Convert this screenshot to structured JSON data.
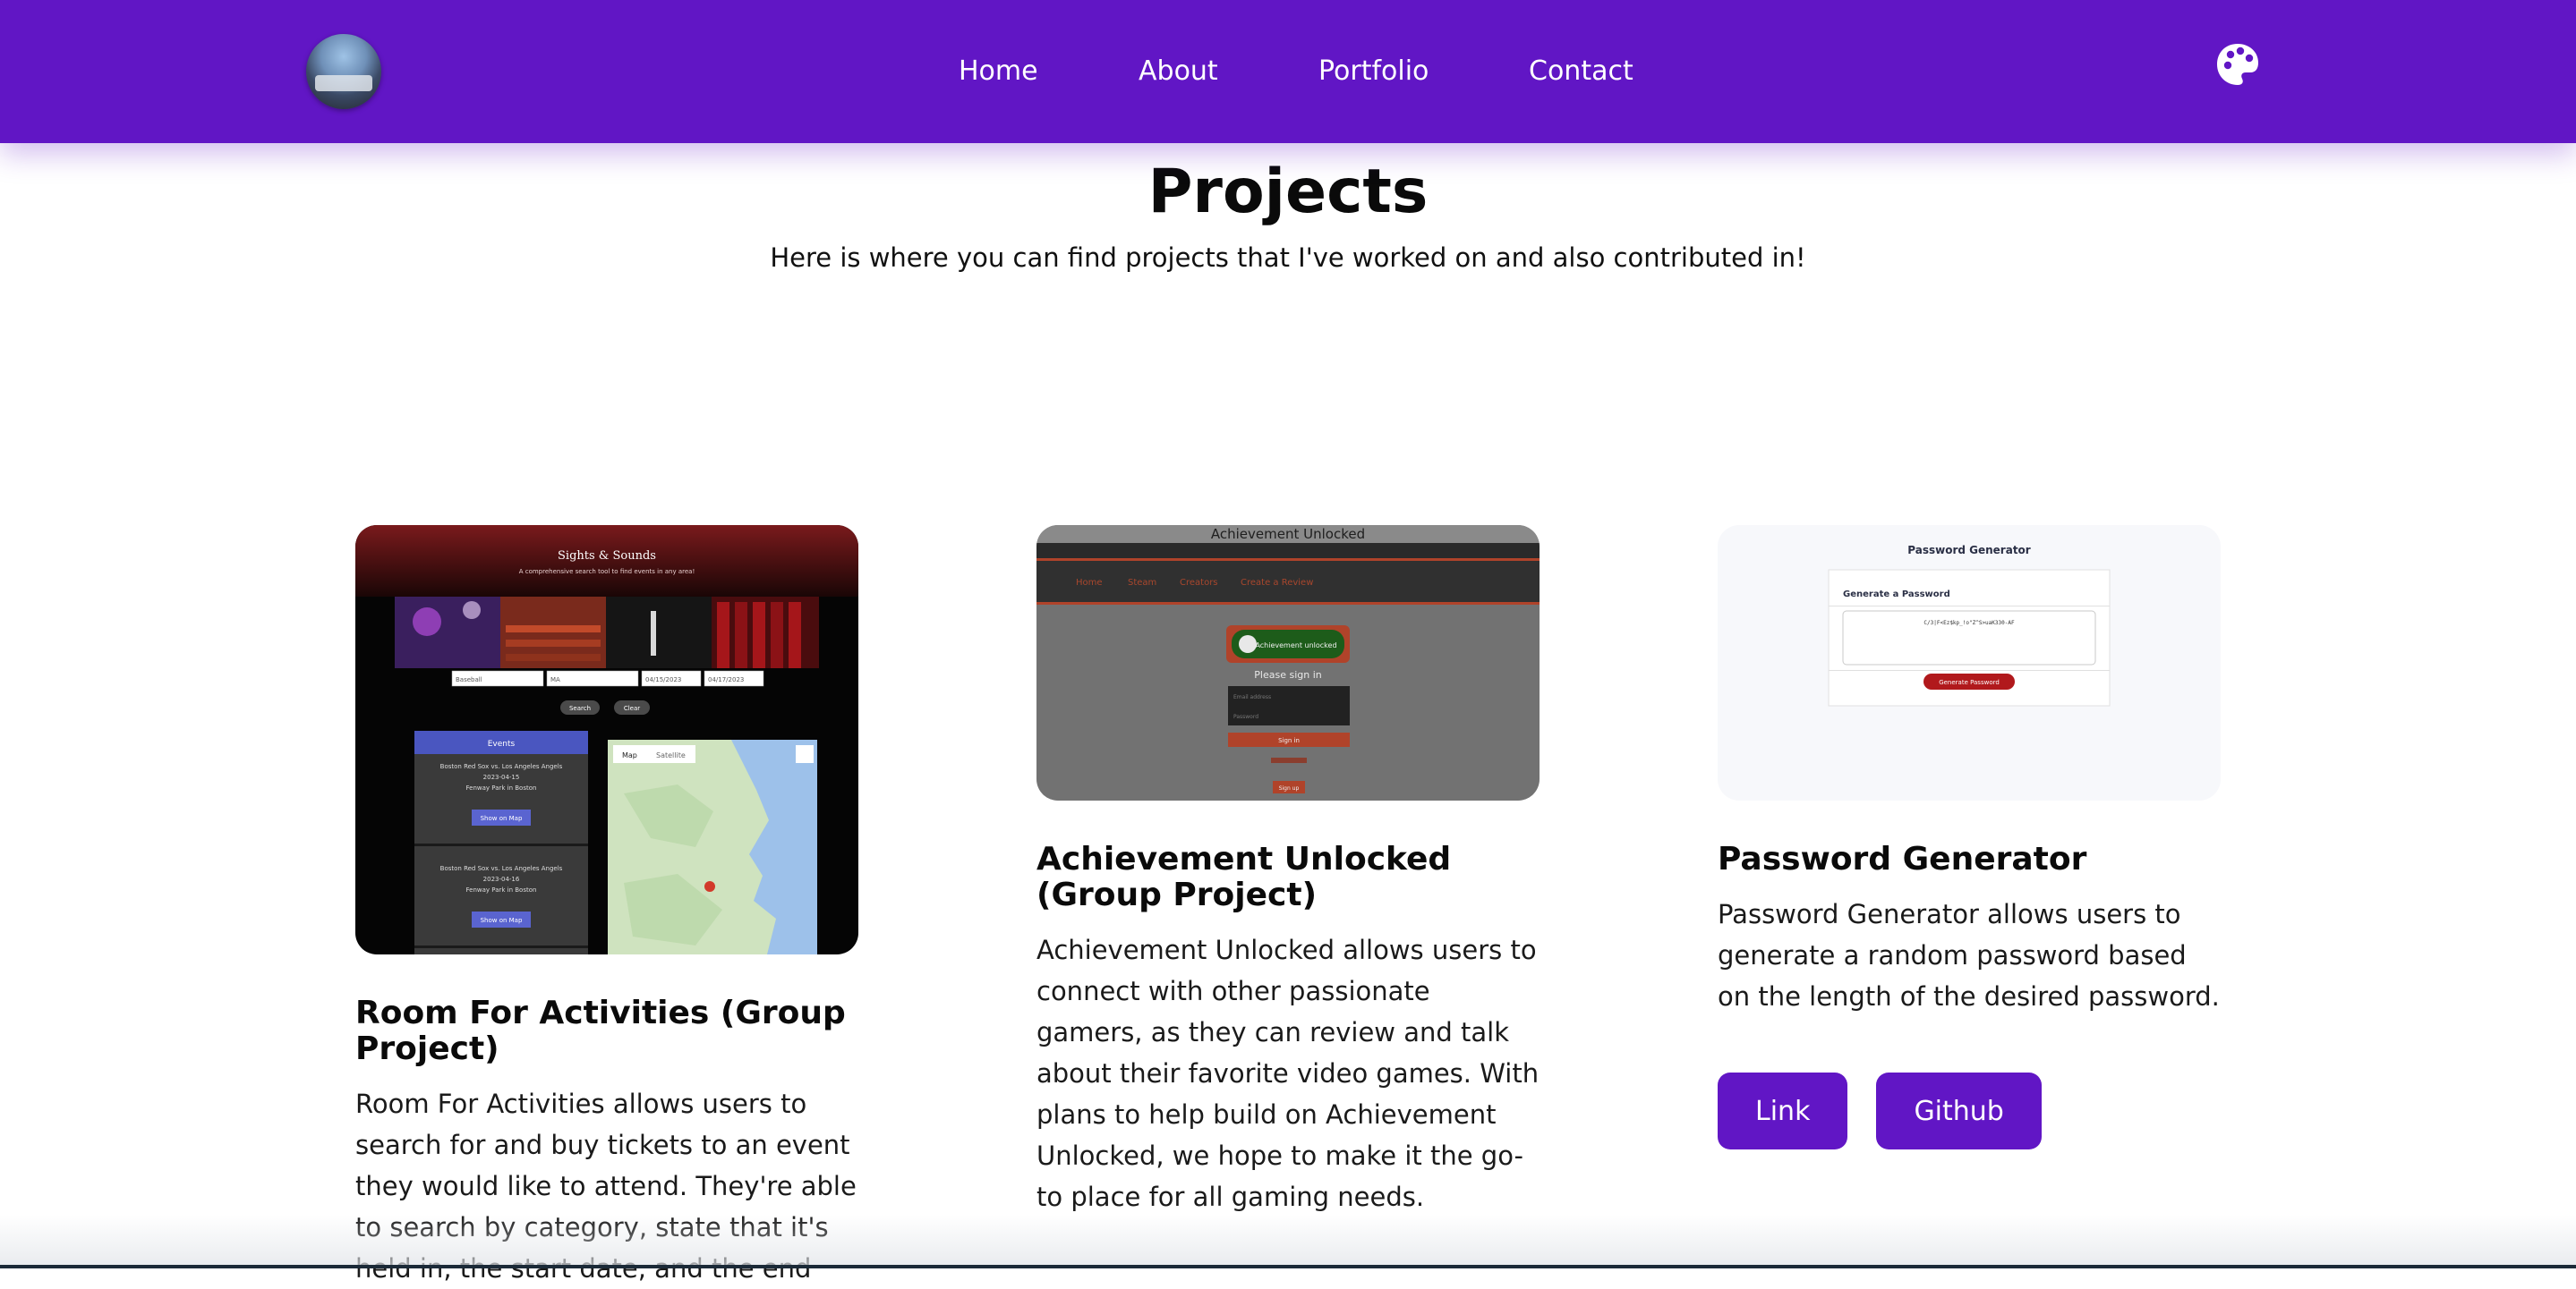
{
  "navbar": {
    "links": [
      "Home",
      "About",
      "Portfolio",
      "Contact"
    ],
    "avatar_icon": "profile-photo",
    "theme_icon": "palette-icon",
    "background": "#6116c5"
  },
  "header": {
    "title": "Projects",
    "subtitle": "Here is where you can find projects that I've worked on and also contributed in!"
  },
  "projects": [
    {
      "title": "Room For Activities (Group Project)",
      "description": "Room For Activities allows users to search for and buy tickets to an event they would like to attend. They're able to search by category, state that it's held in, the start date, and the end",
      "screenshot": {
        "brand": "Sights & Sounds",
        "tagline": "A comprehensive search tool to find events in any area!",
        "inputs": [
          "Baseball",
          "MA",
          "04/15/2023",
          "04/17/2023"
        ],
        "buttons": [
          "Search",
          "Clear"
        ],
        "events_header": "Events",
        "events": [
          {
            "name": "Boston Red Sox vs. Los Angeles Angels",
            "date": "2023-04-15",
            "venue": "Fenway Park in Boston",
            "action": "Show on Map"
          },
          {
            "name": "Boston Red Sox vs. Los Angeles Angels",
            "date": "2023-04-16",
            "venue": "Fenway Park in Boston",
            "action": "Show on Map"
          }
        ],
        "map_tabs": [
          "Map",
          "Satellite"
        ]
      }
    },
    {
      "title": "Achievement Unlocked (Group Project)",
      "description": "Achievement Unlocked allows users to connect with other passionate gamers, as they can review and talk about their favorite video games. With plans to help build on Achievement Unlocked, we hope to make it the go-to place for all gaming needs.",
      "screenshot": {
        "header": "Achievement Unlocked",
        "nav": [
          "Home",
          "Steam",
          "Creators",
          "Create a Review"
        ],
        "badge": "Achievement unlocked",
        "signin_title": "Please sign in",
        "fields": [
          "Email address",
          "Password"
        ],
        "signin_button": "Sign in",
        "signup_button": "Sign up"
      }
    },
    {
      "title": "Password Generator",
      "description": "Password Generator allows users to generate a random password based on the length of the desired password.",
      "buttons": [
        "Link",
        "Github"
      ],
      "screenshot": {
        "header": "Password Generator",
        "card_title": "Generate a Password",
        "password": "C/3|F<Ez$kp_!o\"Z^S>uaK330-AF",
        "button": "Generate Password"
      }
    }
  ]
}
